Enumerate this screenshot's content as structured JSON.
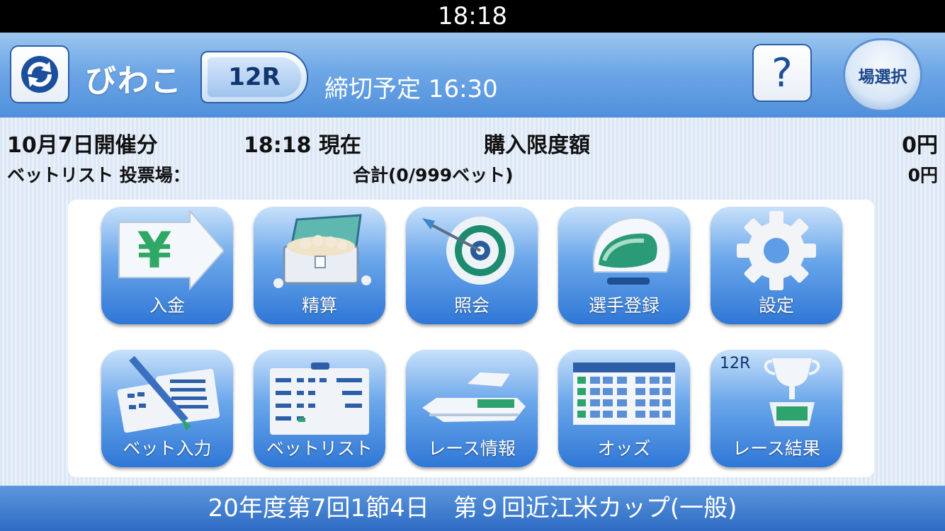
{
  "status_bar": {
    "time": "18:18"
  },
  "header": {
    "venue": "びわこ",
    "race": "12R",
    "deadline": "締切予定 16:30",
    "help_label": "?",
    "venue_select_label": "場選択"
  },
  "info": {
    "date": "10月7日開催分",
    "current_time": "18:18 現在",
    "limit_label": "購入限度額",
    "limit_value": "0円",
    "betlist_label": "ベットリスト 投票場：",
    "total_label": "合計(0/999ベット)",
    "total_value": "0円"
  },
  "menu": {
    "row1": [
      "入金",
      "精算",
      "照会",
      "選手登録",
      "設定"
    ],
    "row2": [
      "ベット入力",
      "ベットリスト",
      "レース情報",
      "オッズ",
      "レース結果"
    ],
    "result_race": "12R"
  },
  "footer": {
    "event": "20年度第7回1節4日　第９回近江米カップ(一般)"
  },
  "colors": {
    "header_blue": "#4f8fdb",
    "tile_blue": "#2f77d6",
    "footer_blue": "#2e6bc3"
  }
}
